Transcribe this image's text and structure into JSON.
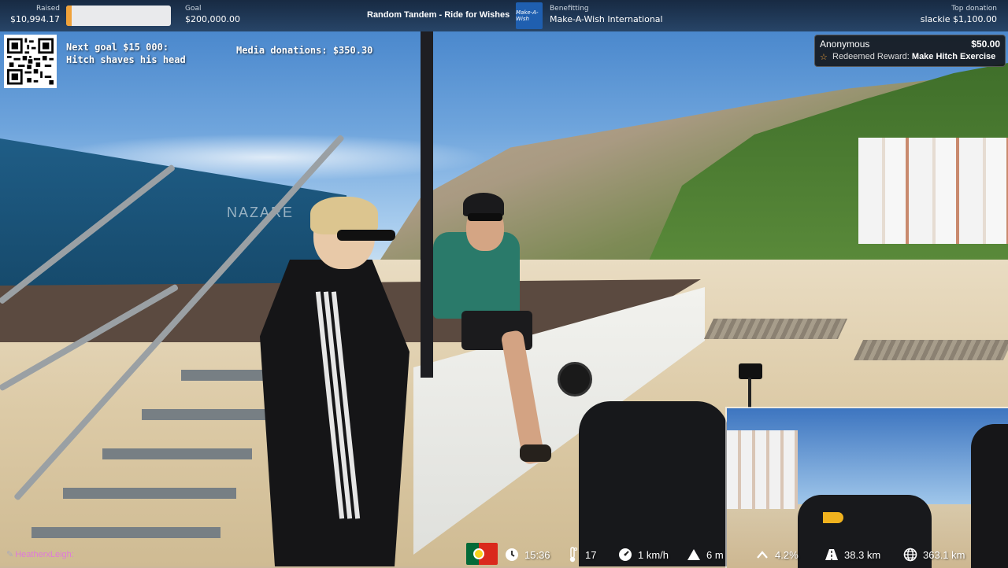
{
  "topbar": {
    "raised_label": "Raised",
    "raised_value": "$10,994.17",
    "goal_label": "Goal",
    "goal_value": "$200,000.00",
    "progress_fraction": 0.055,
    "progress_color": "#f0a23a",
    "stream_title": "Random Tandem - Ride for Wishes",
    "charity_logo_text": "Make-A-Wish",
    "benefit_label": "Benefitting",
    "benefit_value": "Make-A-Wish International",
    "top_donation_label": "Top donation",
    "top_donation_value": "slackie $1,100.00"
  },
  "overlay": {
    "next_goal": "Next goal $15 000: Hitch shaves his head",
    "media_donations": "Media donations: $350.30"
  },
  "alert": {
    "name": "Anonymous",
    "amount": "$50.00",
    "reward_prefix": "Redeemed Reward:",
    "reward_name": "Make Hitch Exercise",
    "star_icon": "star-icon"
  },
  "scene": {
    "banner_text": "NAZARE"
  },
  "chat": {
    "username": "HeatherxLeigh:",
    "icon": "chat-badge-icon"
  },
  "hud": {
    "flag": "portugal-flag-icon",
    "time": "15:36",
    "temperature": "17",
    "speed": "1 km/h",
    "altitude": "6 m",
    "gradient": "4.2%",
    "distance": "38.3 km",
    "total_distance": "363.1 km"
  },
  "colors": {
    "accent": "#f0a23a",
    "chat_name": "#e07ad8",
    "topbar_bg": "#14233a"
  }
}
